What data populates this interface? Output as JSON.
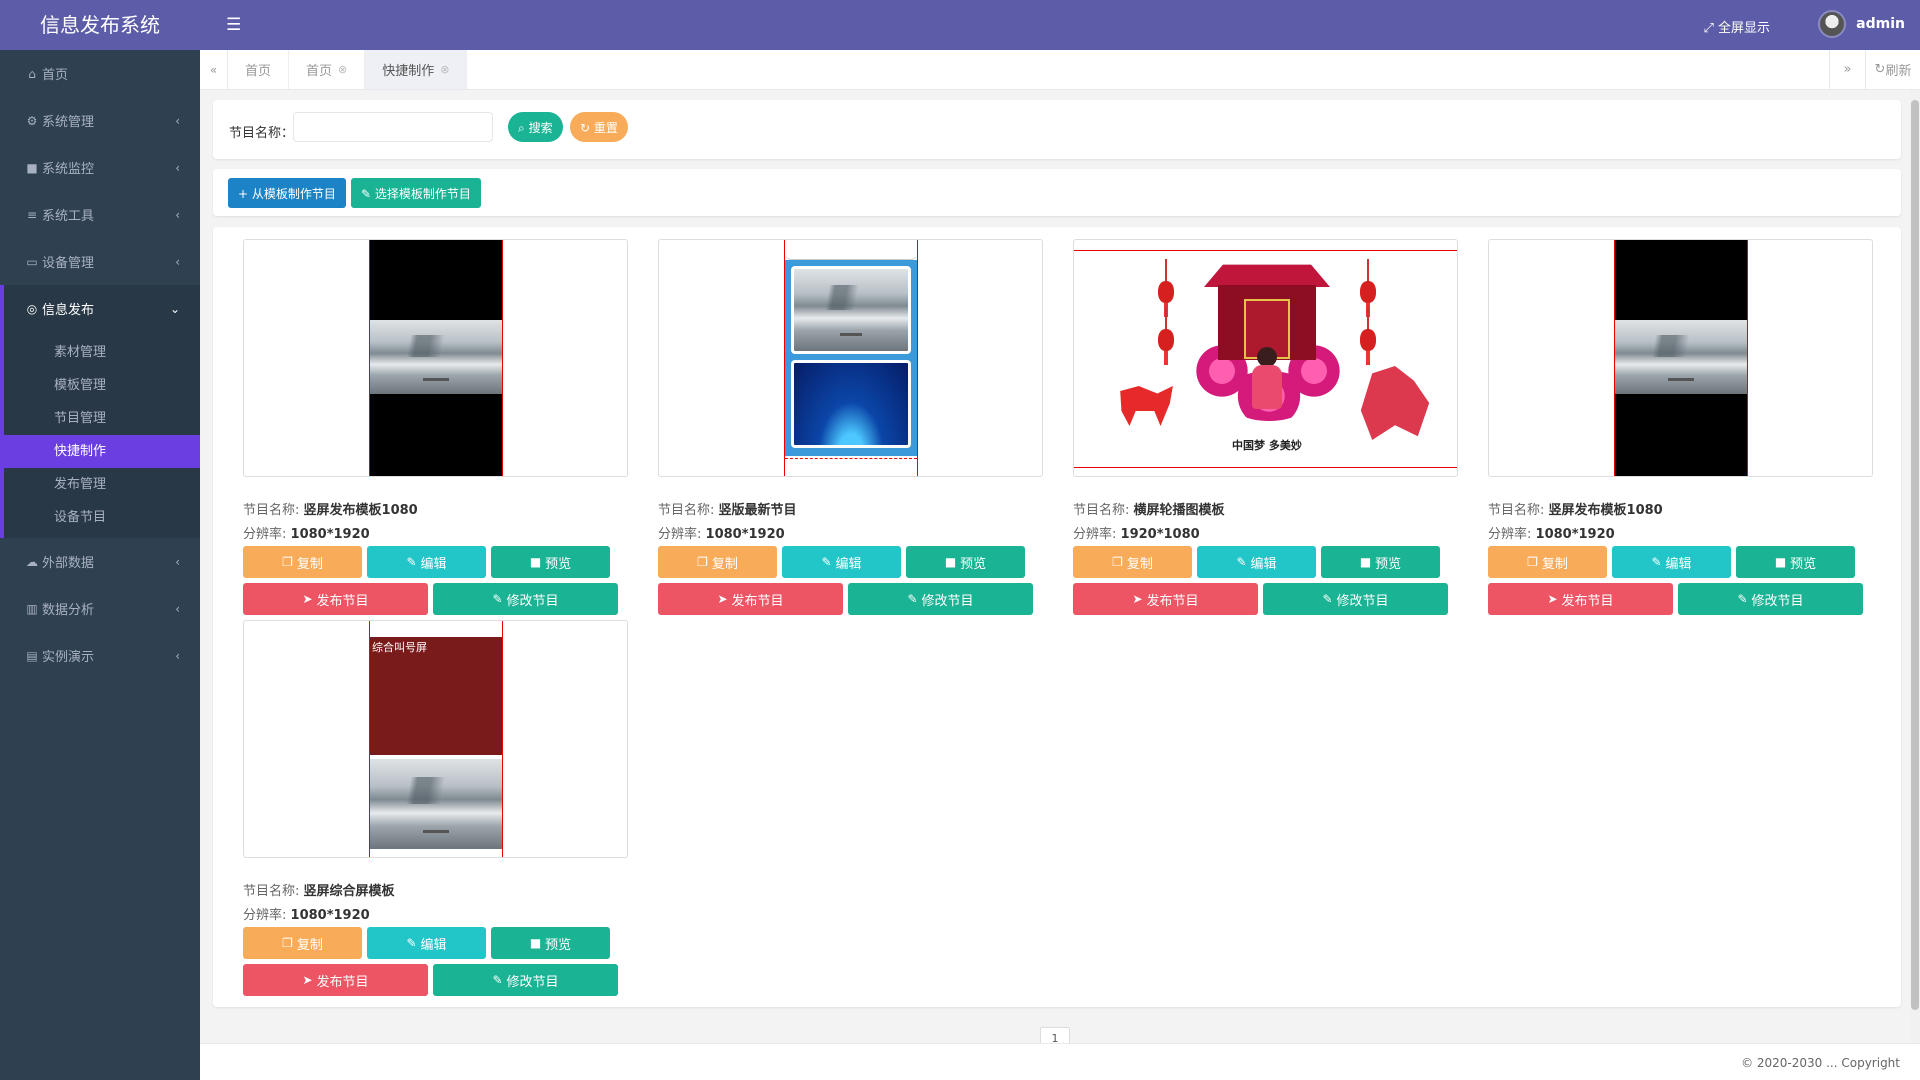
{
  "app": {
    "title": "信息发布系统"
  },
  "topbar": {
    "fullscreen_label": "全屏显示",
    "user_name": "admin"
  },
  "sidebar": {
    "items": [
      {
        "label": "首页",
        "icon": "home-icon"
      },
      {
        "label": "系统管理",
        "icon": "gear-icon"
      },
      {
        "label": "系统监控",
        "icon": "video-icon"
      },
      {
        "label": "系统工具",
        "icon": "list-icon"
      },
      {
        "label": "设备管理",
        "icon": "monitor-icon"
      },
      {
        "label": "信息发布",
        "icon": "compass-icon"
      },
      {
        "label": "外部数据",
        "icon": "cloud-icon"
      },
      {
        "label": "数据分析",
        "icon": "chart-icon"
      },
      {
        "label": "实例演示",
        "icon": "book-icon"
      }
    ],
    "submenu": [
      {
        "label": "素材管理"
      },
      {
        "label": "模板管理"
      },
      {
        "label": "节目管理"
      },
      {
        "label": "快捷制作"
      },
      {
        "label": "发布管理"
      },
      {
        "label": "设备节目"
      }
    ]
  },
  "tabs": [
    {
      "label": "首页"
    },
    {
      "label": "首页"
    },
    {
      "label": "快捷制作"
    }
  ],
  "refresh_label": "刷新",
  "search": {
    "label": "节目名称：",
    "value": "",
    "placeholder": "",
    "search_button": "搜索",
    "reset_button": "重置"
  },
  "actions": {
    "from_template": "从模板制作节目",
    "select_template": "选择模板制作节目"
  },
  "cards": [
    {
      "name_label": "节目名称:",
      "name": "竖屏发布模板1080",
      "res_label": "分辨率:",
      "resolution": "1080*1920"
    },
    {
      "name_label": "节目名称:",
      "name": "竖版最新节目",
      "res_label": "分辨率:",
      "resolution": "1080*1920"
    },
    {
      "name_label": "节目名称:",
      "name": "横屏轮播图模板",
      "res_label": "分辨率:",
      "resolution": "1920*1080",
      "thumb_caption": "中国梦 多美妙"
    },
    {
      "name_label": "节目名称:",
      "name": "竖屏发布模板1080",
      "res_label": "分辨率:",
      "resolution": "1080*1920"
    },
    {
      "name_label": "节目名称:",
      "name": "竖屏综合屏模板",
      "res_label": "分辨率:",
      "resolution": "1080*1920",
      "thumb_caption": "综合叫号屏"
    }
  ],
  "card_buttons": {
    "copy": "复制",
    "edit": "编辑",
    "preview": "预览",
    "publish": "发布节目",
    "modify": "修改节目"
  },
  "pagination": {
    "current": "1"
  },
  "footer": {
    "text": "© 2020-2030 ... Copyright"
  },
  "colors": {
    "header": "#5c5ca8",
    "sidebar": "#2f4050",
    "active": "#6a3ee0",
    "primary": "#1ab394",
    "warning": "#f8ac59",
    "info": "#23c6c8",
    "danger": "#ed5565",
    "blue": "#1c84c6"
  }
}
